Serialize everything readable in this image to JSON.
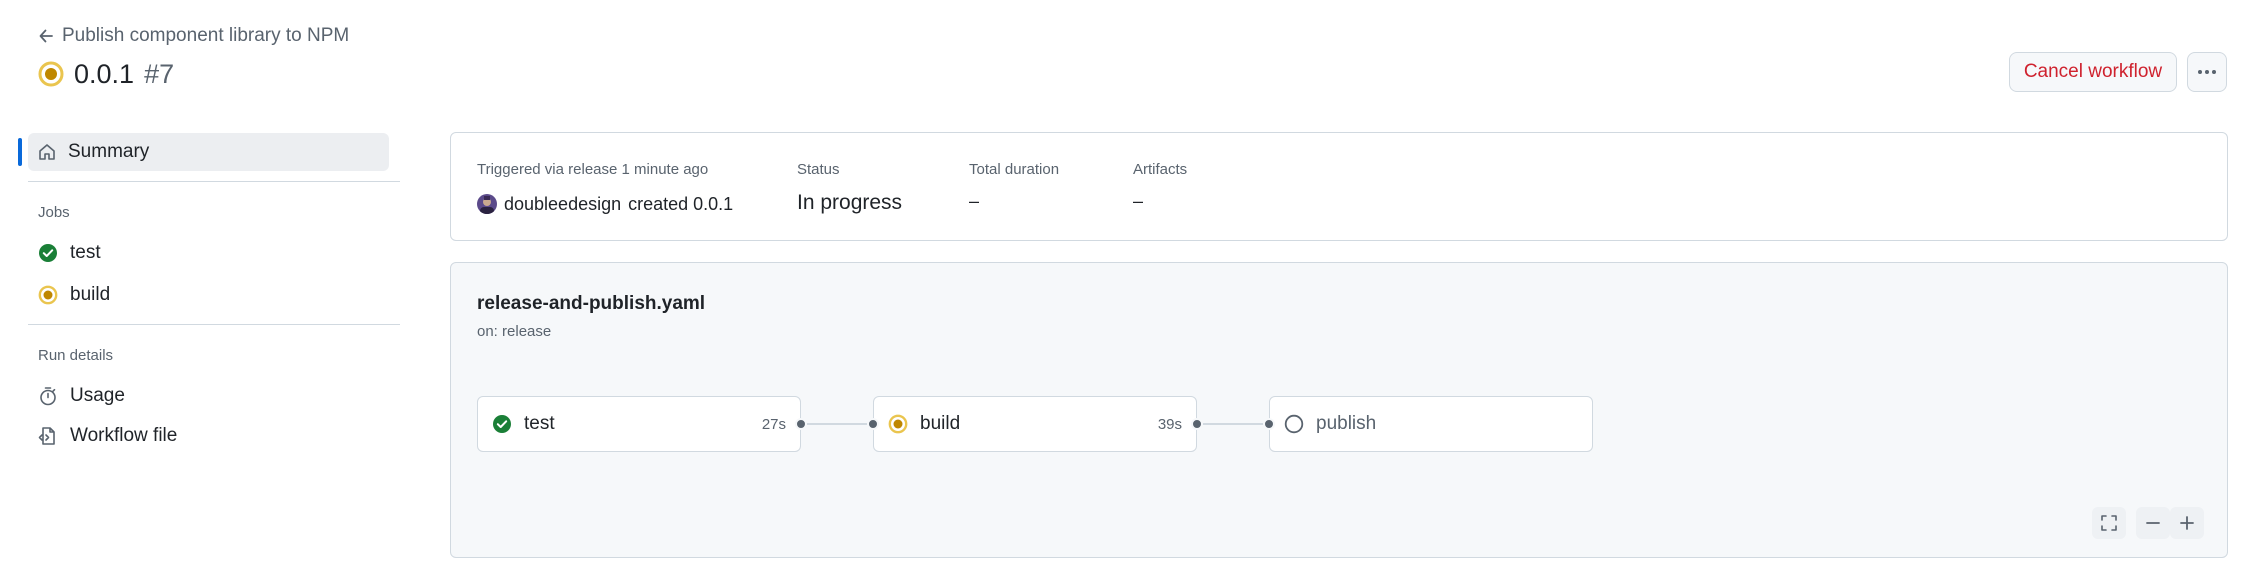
{
  "header": {
    "back_label": "Publish component library to NPM",
    "run_version": "0.0.1",
    "run_number": "#7",
    "cancel_label": "Cancel workflow"
  },
  "sidebar": {
    "summary_label": "Summary",
    "jobs_heading": "Jobs",
    "jobs": [
      {
        "label": "test",
        "status": "success"
      },
      {
        "label": "build",
        "status": "in_progress"
      }
    ],
    "run_details_heading": "Run details",
    "details": [
      {
        "label": "Usage",
        "icon": "stopwatch-icon"
      },
      {
        "label": "Workflow file",
        "icon": "file-code-icon"
      }
    ]
  },
  "summary": {
    "trigger_label": "Triggered via release 1 minute ago",
    "actor": "doubleedesign",
    "trigger_action": "created 0.0.1",
    "status_label": "Status",
    "status_value": "In progress",
    "duration_label": "Total duration",
    "duration_value": "–",
    "artifacts_label": "Artifacts",
    "artifacts_value": "–"
  },
  "graph": {
    "workflow_file": "release-and-publish.yaml",
    "trigger": "on: release",
    "jobs": [
      {
        "label": "test",
        "duration": "27s",
        "status": "success"
      },
      {
        "label": "build",
        "duration": "39s",
        "status": "in_progress"
      },
      {
        "label": "publish",
        "duration": "",
        "status": "queued"
      }
    ]
  },
  "colors": {
    "success": "#1a7f37",
    "in_progress": "#bf8700",
    "in_progress_ring": "#eac54f",
    "danger": "#cf222e",
    "accent": "#0969da",
    "muted": "#59636e",
    "border": "#d1d9e0"
  }
}
